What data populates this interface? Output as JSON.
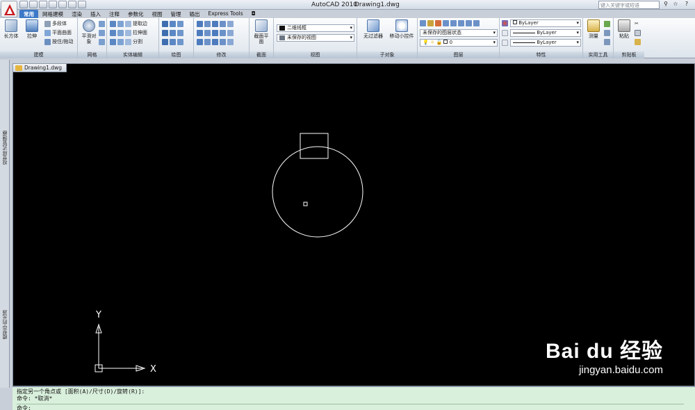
{
  "title_bar": {
    "app_name": "AutoCAD 2010",
    "file_name": "Drawing1.dwg",
    "search_placeholder": "键入关键字或短语"
  },
  "ribbon_tabs": [
    "常用",
    "网格建模",
    "渲染",
    "插入",
    "注释",
    "参数化",
    "视图",
    "管理",
    "输出",
    "Express Tools"
  ],
  "ribbon": {
    "modeling": {
      "title": "建模",
      "box": "长方体",
      "extrude": "拉伸",
      "polysolid": "多段体",
      "planar_surface": "平面曲面",
      "presspull": "按住/拖动"
    },
    "mesh": {
      "title": "网格",
      "smooth": "平滑对象"
    },
    "solid_edit": {
      "title": "实体编辑",
      "extract_edges": "提取边",
      "extrude_faces": "拉伸面",
      "separate": "分割"
    },
    "draw": {
      "title": "绘图"
    },
    "modify": {
      "title": "修改"
    },
    "section": {
      "title": "截面",
      "section_plane": "截面平面"
    },
    "view": {
      "title": "视图",
      "visual_style": "二维线框",
      "saved_view": "未保存的视图"
    },
    "subobject": {
      "title": "子对象",
      "no_filter": "无过滤器",
      "gizmo": "移动小控件"
    },
    "layers": {
      "title": "图层",
      "layer_state": "未保存的图层状态",
      "current_layer": "0"
    },
    "properties": {
      "title": "特性",
      "color": "ByLayer",
      "linetype": "ByLayer",
      "lineweight": "ByLayer"
    },
    "utilities": {
      "title": "实用工具",
      "measure": "测量"
    },
    "clipboard": {
      "title": "剪贴板",
      "paste": "粘贴"
    }
  },
  "left_palettes": {
    "top": "视觉样式管理器",
    "bottom": "模型中的光源"
  },
  "document": {
    "tab_label": "Drawing1.dwg"
  },
  "ucs": {
    "x_label": "X",
    "y_label": "Y"
  },
  "command_line": {
    "line1": "指定另一个角点或 [面积(A)/尺寸(D)/旋转(R)]:",
    "line2": "命令: *取消*",
    "line3": "命令:"
  },
  "watermark": {
    "brand": "Bai du 经验",
    "url": "jingyan.baidu.com"
  },
  "colors": {
    "canvas": "#000000",
    "geometry": "#ffffff",
    "active_tab": "#3c79c8",
    "command_bg": "#d9f0dc"
  }
}
